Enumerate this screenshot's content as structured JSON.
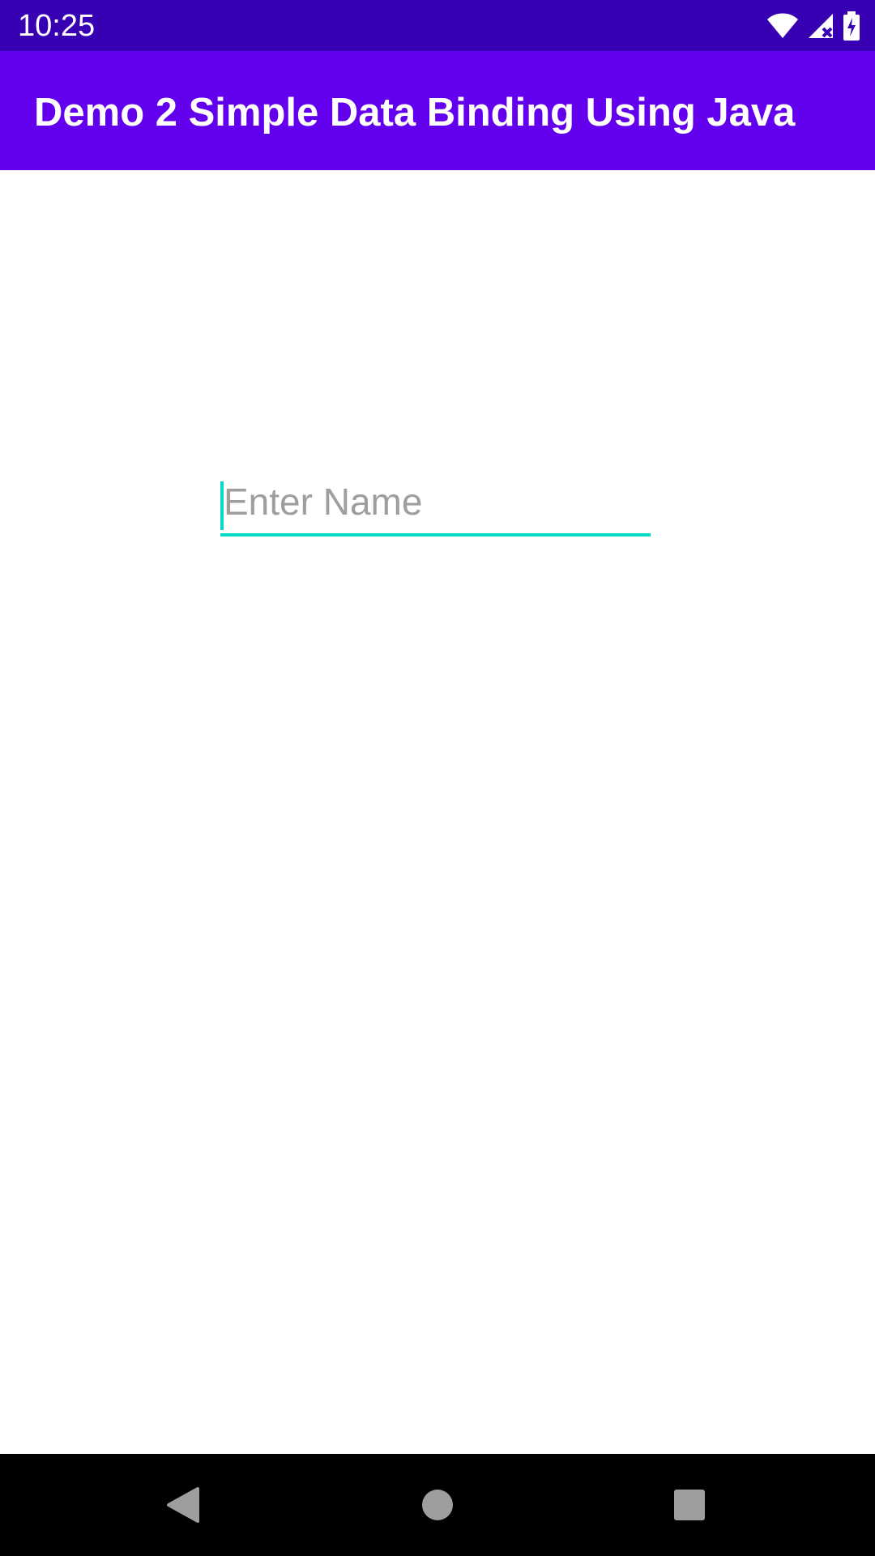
{
  "status_bar": {
    "time": "10:25",
    "icons": [
      "wifi-icon",
      "cell-signal-icon",
      "battery-charging-icon"
    ]
  },
  "app_bar": {
    "title": "Demo 2 Simple Data Binding Using Java"
  },
  "form": {
    "name_field": {
      "placeholder": "Enter Name",
      "value": ""
    }
  },
  "nav_bar": {
    "buttons": [
      "back-icon",
      "home-icon",
      "recents-icon"
    ]
  },
  "colors": {
    "primary": "#6200EE",
    "primary_dark": "#3700B3",
    "accent": "#03DAC5"
  }
}
